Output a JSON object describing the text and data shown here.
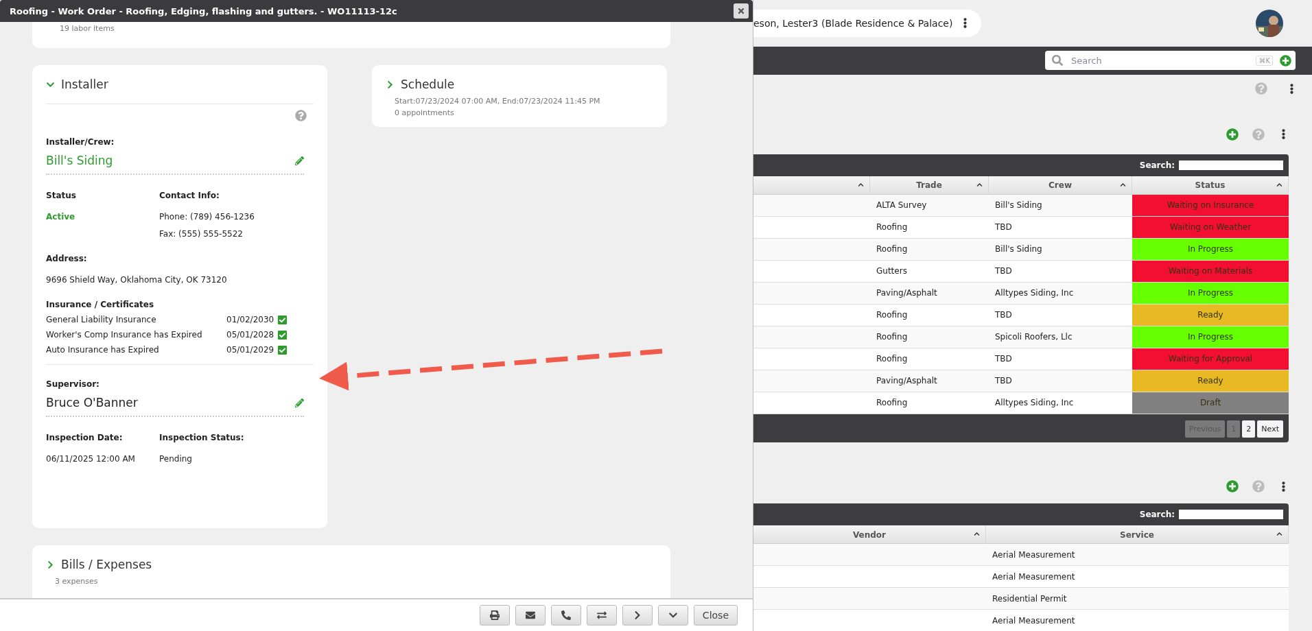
{
  "dialog": {
    "title": "Roofing - Work Order - Roofing, Edging, flashing and gutters. - WO11113-12c",
    "top_card": {
      "subtitle": "19 labor items"
    },
    "installer": {
      "heading": "Installer",
      "expanded": true,
      "crew_label": "Installer/Crew:",
      "crew": "Bill's Siding",
      "status_label": "Status",
      "status": "Active",
      "contact_label": "Contact Info:",
      "phone": "Phone: (789) 456-1236",
      "fax": "Fax: (555) 555-5522",
      "address_label": "Address:",
      "address": "9696 Shield Way, Oklahoma City, OK 73120",
      "insurance_label": "Insurance / Certificates",
      "insurance": [
        {
          "name": "General Liability Insurance",
          "date": "01/02/2030",
          "checked": true
        },
        {
          "name": "Worker's Comp Insurance has Expired",
          "date": "05/01/2028",
          "checked": true
        },
        {
          "name": "Auto Insurance has Expired",
          "date": "05/01/2029",
          "checked": true
        }
      ],
      "supervisor_label": "Supervisor:",
      "supervisor": "Bruce O'Banner",
      "inspection_date_label": "Inspection Date:",
      "inspection_date": "06/11/2025 12:00 AM",
      "inspection_status_label": "Inspection Status:",
      "inspection_status": "Pending"
    },
    "schedule": {
      "heading": "Schedule",
      "expanded": false,
      "lines": [
        "Start:07/23/2024 07:00 AM, End:07/23/2024 11:45 PM",
        "0 appointments"
      ]
    },
    "bills": {
      "heading": "Bills / Expenses",
      "expanded": false,
      "lines": [
        "3 expenses"
      ]
    },
    "close_button": "Close"
  },
  "page": {
    "breadcrumb": "eson, Lester3 (Blade Residence & Palace)",
    "search": {
      "placeholder": "Search",
      "shortcut": "⌘K"
    },
    "work_orders": {
      "search_label": "Search:",
      "columns": [
        "Trade",
        "Crew",
        "Status"
      ],
      "rows": [
        {
          "trade": "ALTA Survey",
          "crew": "Bill's Siding",
          "status": "Waiting on Insurance",
          "color": "#f20f31"
        },
        {
          "trade": "Roofing",
          "crew": "TBD",
          "status": "Waiting on Weather",
          "color": "#f20f31"
        },
        {
          "trade": "Roofing",
          "crew": "Bill's Siding",
          "status": "In Progress",
          "color": "#66ff00"
        },
        {
          "trade": "Gutters",
          "crew": "TBD",
          "status": "Waiting on Materials",
          "color": "#f20f31"
        },
        {
          "trade": "Paving/Asphalt",
          "crew": "Alltypes Siding, Inc",
          "status": "In Progress",
          "color": "#66ff00"
        },
        {
          "trade": "Roofing",
          "crew": "TBD",
          "status": "Ready",
          "color": "#e8b923"
        },
        {
          "trade": "Roofing",
          "crew": "Spicoli Roofers, Llc",
          "status": "In Progress",
          "color": "#66ff00"
        },
        {
          "trade": "Roofing",
          "crew": "TBD",
          "status": "Waiting for Approval",
          "color": "#f20f31"
        },
        {
          "trade": "Paving/Asphalt",
          "crew": "TBD",
          "status": "Ready",
          "color": "#e8b923"
        },
        {
          "trade": "Roofing",
          "crew": "Alltypes Siding, Inc",
          "status": "Draft",
          "color": "#808080"
        }
      ],
      "pagination": {
        "previous": {
          "label": "Previous",
          "disabled": true
        },
        "pages": [
          {
            "label": "1",
            "selected": true
          },
          {
            "label": "2",
            "selected": false
          }
        ],
        "next": {
          "label": "Next",
          "disabled": false
        }
      }
    },
    "vendors": {
      "search_label": "Search:",
      "columns": [
        "Vendor",
        "Service"
      ],
      "rows": [
        {
          "service": "Aerial Measurement"
        },
        {
          "service": "Aerial Measurement"
        },
        {
          "service": "Residential Permit"
        },
        {
          "service": "Aerial Measurement"
        }
      ]
    }
  }
}
